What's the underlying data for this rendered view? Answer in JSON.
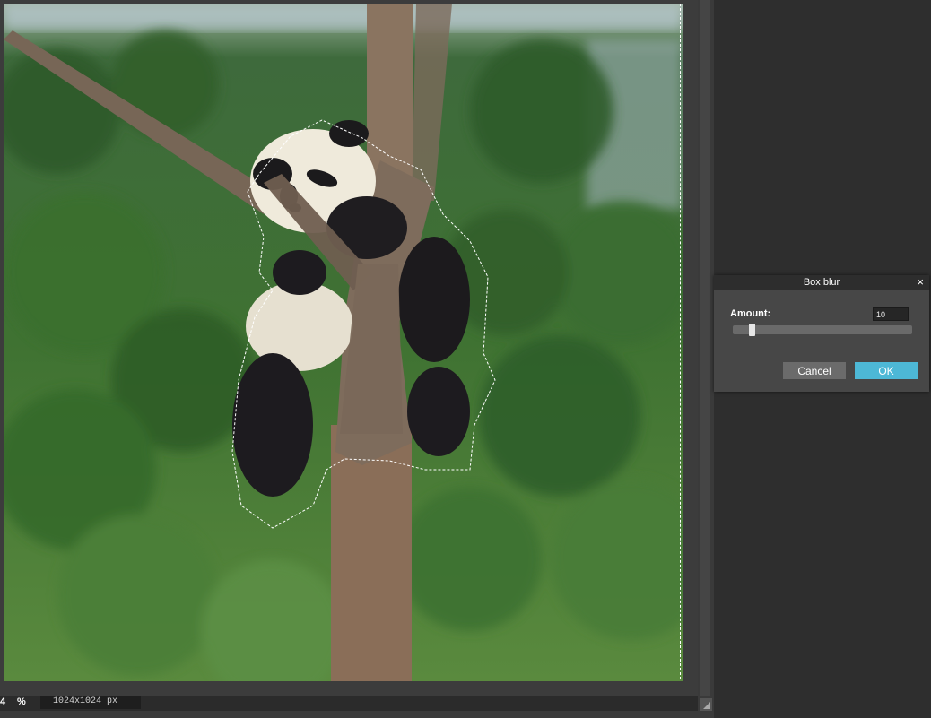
{
  "status_bar": {
    "zoom_value": "4",
    "zoom_unit": "%",
    "document_size": "1024x1024 px"
  },
  "canvas": {
    "image_subject": "panda-photo",
    "selection": "marching-ants"
  },
  "dialog": {
    "title": "Box blur",
    "close_glyph": "×",
    "amount_label": "Amount:",
    "amount_value": "10",
    "amount_fraction": 0.05,
    "cancel_label": "Cancel",
    "ok_label": "OK"
  },
  "colors": {
    "ok_button": "#4db8d6",
    "cancel_button": "#6b6b6b",
    "panel_background": "#2e2e2e",
    "dialog_background": "#474747"
  },
  "icons": {
    "resize_grip": "resize-grip-icon",
    "close": "close-icon"
  }
}
